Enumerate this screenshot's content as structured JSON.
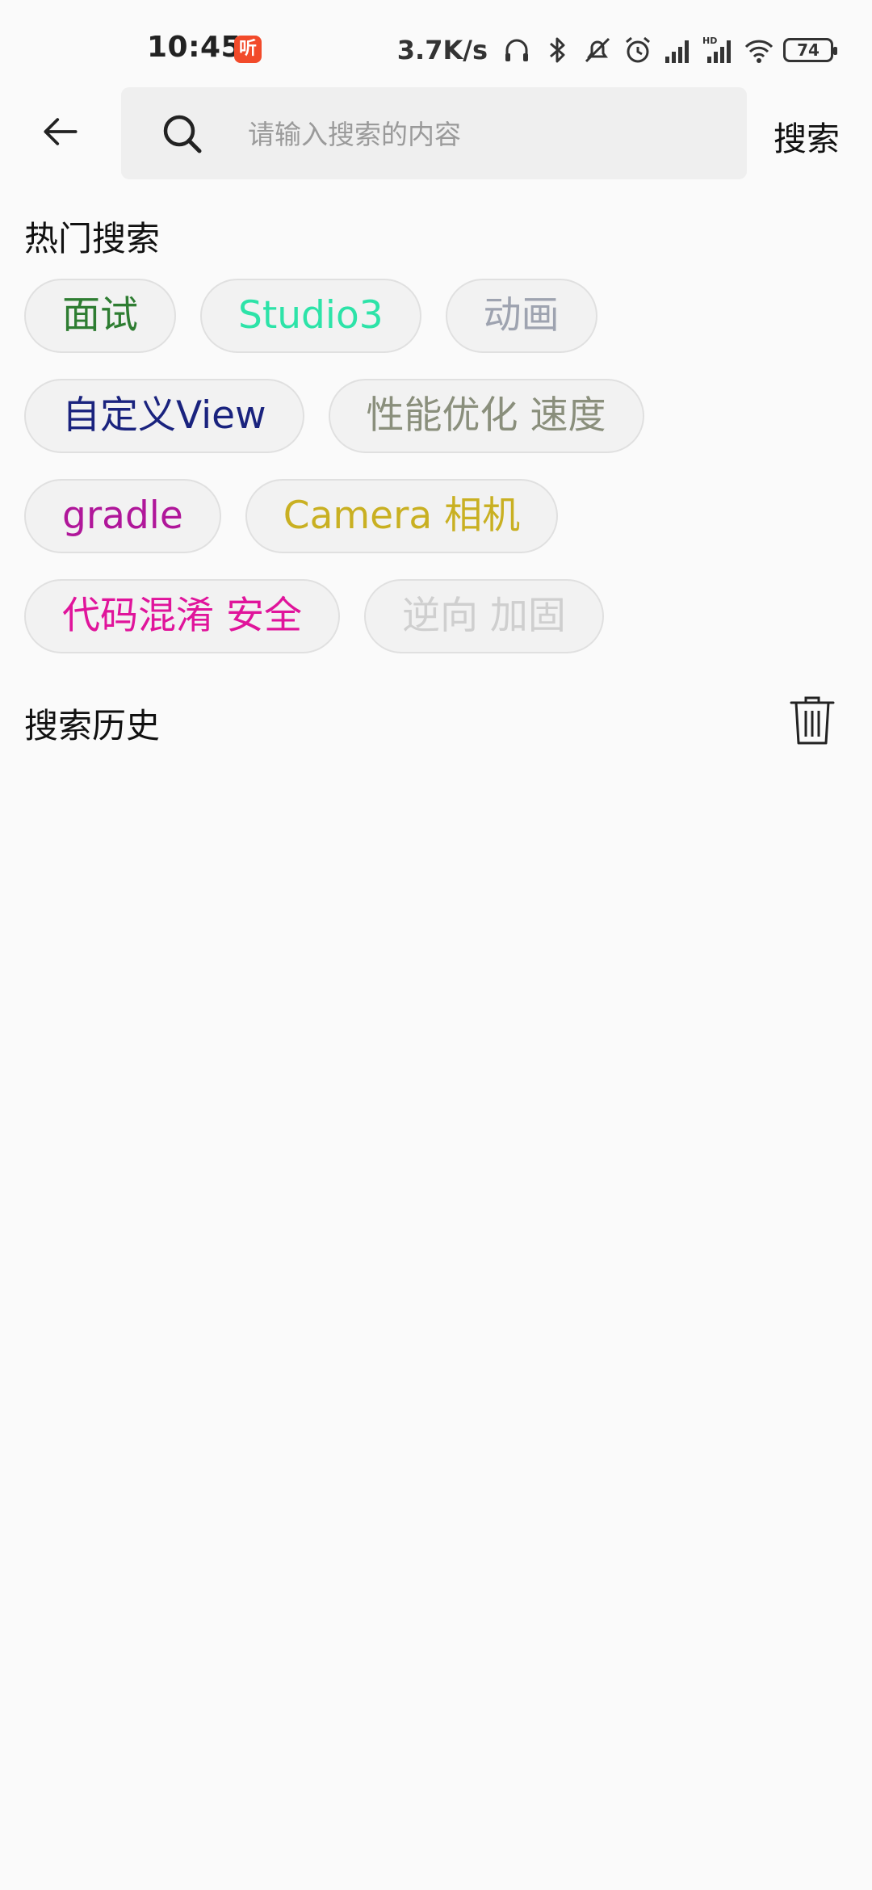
{
  "status_bar": {
    "time": "10:45",
    "app_badge": "听",
    "net_speed": "3.7K/s",
    "battery": "74",
    "icons": [
      "headphones-icon",
      "bluetooth-icon",
      "mute-icon",
      "alarm-icon",
      "signal-icon",
      "hd-signal-icon",
      "wifi-icon",
      "battery-icon"
    ]
  },
  "header": {
    "back_icon": "back-arrow-icon",
    "search_placeholder": "请输入搜索的内容",
    "search_value": "",
    "search_button": "搜索"
  },
  "hot_search": {
    "title": "热门搜索",
    "tags": [
      {
        "label": "面试",
        "color": "#2e7d32"
      },
      {
        "label": "Studio3",
        "color": "#2de3a8"
      },
      {
        "label": "动画",
        "color": "#9ea3b0"
      },
      {
        "label": "自定义View",
        "color": "#1a237e"
      },
      {
        "label": "性能优化 速度",
        "color": "#8a8f7c"
      },
      {
        "label": "gradle",
        "color": "#b0179a"
      },
      {
        "label": "Camera 相机",
        "color": "#c9b022"
      },
      {
        "label": "代码混淆 安全",
        "color": "#e0149b"
      },
      {
        "label": "逆向 加固",
        "color": "#cfcfcf"
      }
    ]
  },
  "history": {
    "title": "搜索历史",
    "clear_icon": "trash-icon",
    "items": []
  }
}
